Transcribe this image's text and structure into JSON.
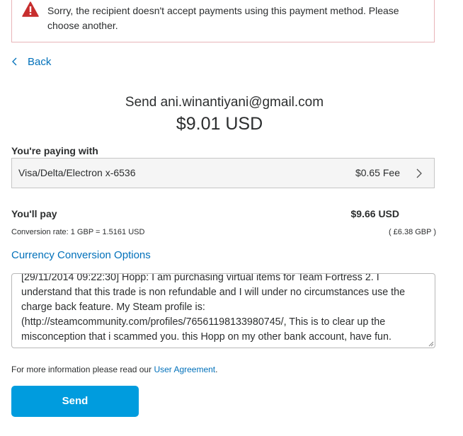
{
  "alert": {
    "icon": "warning-triangle-icon",
    "message": "Sorry, the recipient doesn't accept payments using this payment method. Please choose another.",
    "color": "#c72e2e"
  },
  "nav": {
    "back_label": "Back",
    "back_icon": "chevron-left-icon"
  },
  "recipient": {
    "send_to": "Send ani.winantiyani@gmail.com",
    "amount": "$9.01 USD"
  },
  "payment": {
    "label": "You're paying with",
    "method": "Visa/Delta/Electron x-6536",
    "fee": "$0.65 Fee",
    "chevron_icon": "chevron-right-icon"
  },
  "total": {
    "label": "You'll pay",
    "amount": "$9.66 USD",
    "conversion_rate": "Conversion rate: 1 GBP = 1.5161 USD",
    "gbp_amount": "( £6.38 GBP )"
  },
  "currency_link": "Currency Conversion Options",
  "note": {
    "text": "[29/11/2014 09:22:30] Hopp: I am purchasing virtual items for Team Fortress 2. I understand that this trade is non refundable and I will under no circumstances use the charge back feature. My Steam profile is: (http://steamcommunity.com/profiles/76561198133980745/, This is to clear up the misconception that i scammed you. this Hopp on my other bank account, have fun."
  },
  "agreement": {
    "prefix": "For more information please read our ",
    "link": "User Agreement",
    "suffix": "."
  },
  "send_button": {
    "label": "Send",
    "color": "#009cde"
  },
  "colors": {
    "link": "#0070ba",
    "text": "#2c2e2f",
    "alert_border": "#e8b4b8"
  }
}
